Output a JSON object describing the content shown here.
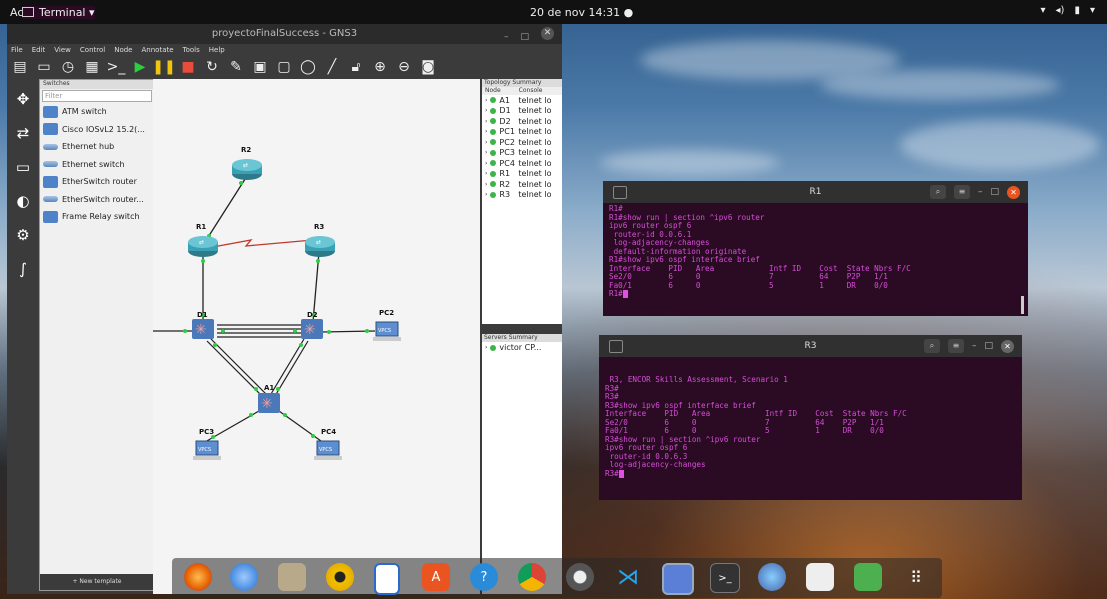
{
  "topbar": {
    "activities": "Actividades",
    "terminal_menu": "Terminal ▾",
    "clock": "20 de nov  14:31  ●",
    "tray": [
      "▾",
      "◂)",
      "▮",
      "▾"
    ]
  },
  "gns3": {
    "title": "proyectoFinalSuccess - GNS3",
    "menu": [
      "File",
      "Edit",
      "View",
      "Control",
      "Node",
      "Annotate",
      "Tools",
      "Help"
    ],
    "devices_header": "Switches",
    "filter_placeholder": "Filter",
    "devices": [
      {
        "label": "ATM switch",
        "icon": "atm-switch-icon"
      },
      {
        "label": "Cisco IOSvL2 15.2(...",
        "icon": "cisco-switch-icon"
      },
      {
        "label": "Ethernet hub",
        "icon": "ethernet-hub-icon"
      },
      {
        "label": "Ethernet switch",
        "icon": "ethernet-switch-icon"
      },
      {
        "label": "EtherSwitch router",
        "icon": "etherswitch-router-icon"
      },
      {
        "label": "EtherSwitch router...",
        "icon": "etherswitch-router-icon"
      },
      {
        "label": "Frame Relay switch",
        "icon": "frame-relay-icon"
      }
    ],
    "new_template": "New template",
    "topology": {
      "header": "Topology Summary",
      "col_node": "Node",
      "col_console": "Console",
      "rows": [
        {
          "node": "A1",
          "console": "telnet lo"
        },
        {
          "node": "D1",
          "console": "telnet lo"
        },
        {
          "node": "D2",
          "console": "telnet lo"
        },
        {
          "node": "PC1",
          "console": "telnet lo"
        },
        {
          "node": "PC2",
          "console": "telnet lo"
        },
        {
          "node": "PC3",
          "console": "telnet lo"
        },
        {
          "node": "PC4",
          "console": "telnet lo"
        },
        {
          "node": "R1",
          "console": "telnet lo"
        },
        {
          "node": "R2",
          "console": "telnet lo"
        },
        {
          "node": "R3",
          "console": "telnet lo"
        }
      ]
    },
    "servers": {
      "header": "Servers Summary",
      "rows": [
        "victor CP..."
      ]
    },
    "nodes": {
      "r2": "R2",
      "r1": "R1",
      "r3": "R3",
      "d1": "D1",
      "d2": "D2",
      "a1": "A1",
      "pc2": "PC2",
      "pc3": "PC3",
      "pc4": "PC4",
      "vpcs": "VPCS"
    }
  },
  "term_r1": {
    "title": "R1",
    "lines": [
      "R1#",
      "R1#show run | section ^ipv6 router",
      "ipv6 router ospf 6",
      " router-id 0.0.6.1",
      " log-adjacency-changes",
      " default-information originate",
      "R1#show ipv6 ospf interface brief",
      "Interface    PID   Area            Intf ID    Cost  State Nbrs F/C",
      "Se2/0        6     0               7          64    P2P   1/1",
      "Fa0/1        6     0               5          1     DR    0/0"
    ],
    "prompt": "R1#"
  },
  "term_r3": {
    "title": "R3",
    "lines": [
      "",
      "",
      " R3, ENCOR Skills Assessment, Scenario 1",
      "R3#",
      "R3#",
      "R3#show ipv6 ospf interface brief",
      "Interface    PID   Area            Intf ID    Cost  State Nbrs F/C",
      "Se2/0        6     0               7          64    P2P   1/1",
      "Fa0/1        6     0               5          1     DR    0/0",
      "R3#show run | section ^ipv6 router",
      "ipv6 router ospf 6",
      " router-id 0.0.6.3",
      " log-adjacency-changes"
    ],
    "prompt": "R3#"
  },
  "dock": [
    "firefox-icon",
    "thunderbird-icon",
    "files-icon",
    "rhythmbox-icon",
    "writer-icon",
    "software-icon",
    "help-icon",
    "chrome-icon",
    "settings-icon",
    "vscode-icon",
    "screenshot-icon",
    "terminal-icon",
    "gns3-icon",
    "texteditor-icon",
    "trash-icon",
    "app-grid-icon"
  ]
}
